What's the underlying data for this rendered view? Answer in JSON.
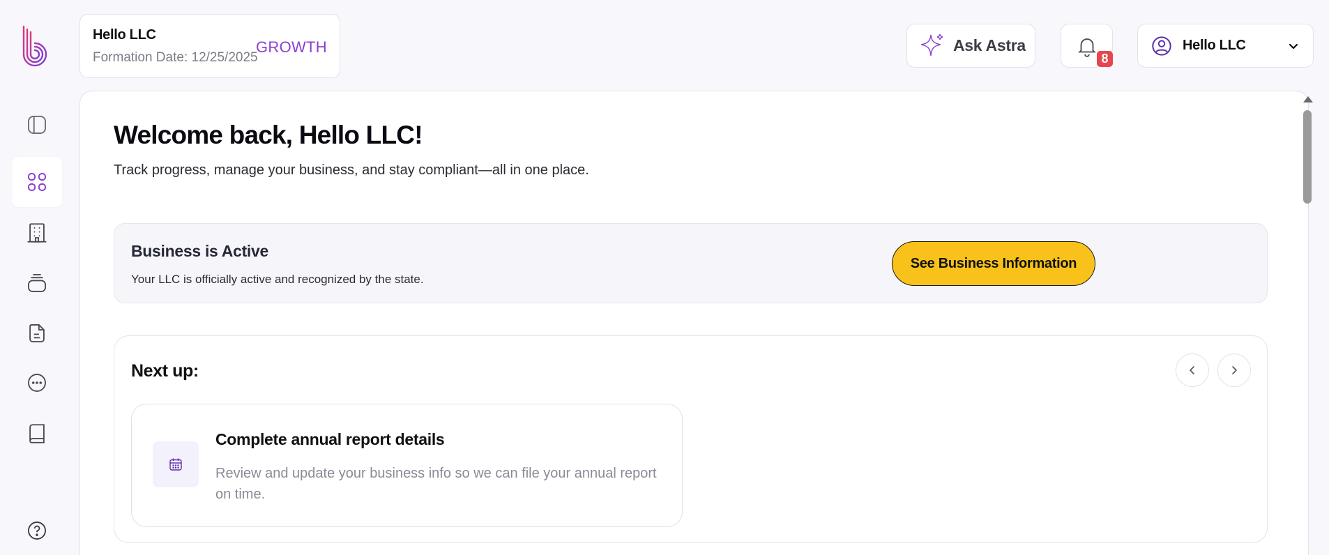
{
  "header": {
    "business_name": "Hello LLC",
    "formation_date": "Formation Date: 12/25/2025",
    "plan": "GROWTH",
    "ask_label": "Ask Astra",
    "notification_count": "8",
    "user_name": "Hello LLC"
  },
  "main": {
    "title": "Welcome back, Hello LLC!",
    "subtitle": "Track progress, manage your business, and stay compliant—all in one place."
  },
  "status": {
    "title": "Business is Active",
    "description": "Your LLC is officially active and recognized by the state.",
    "button_label": "See Business Information"
  },
  "next_up": {
    "title": "Next up:",
    "task": {
      "title": "Complete annual report details",
      "description": "Review and update your business info so we can file your annual report on time."
    }
  },
  "colors": {
    "brand_purple": "#8a3fd1",
    "accent_yellow": "#f8c21a",
    "badge_red": "#e8454f"
  },
  "icons": {
    "sidebar": [
      "sidebar-toggle-icon",
      "dashboard-grid-icon",
      "building-icon",
      "layers-icon",
      "document-icon",
      "chat-icon",
      "book-icon",
      "help-icon"
    ]
  }
}
